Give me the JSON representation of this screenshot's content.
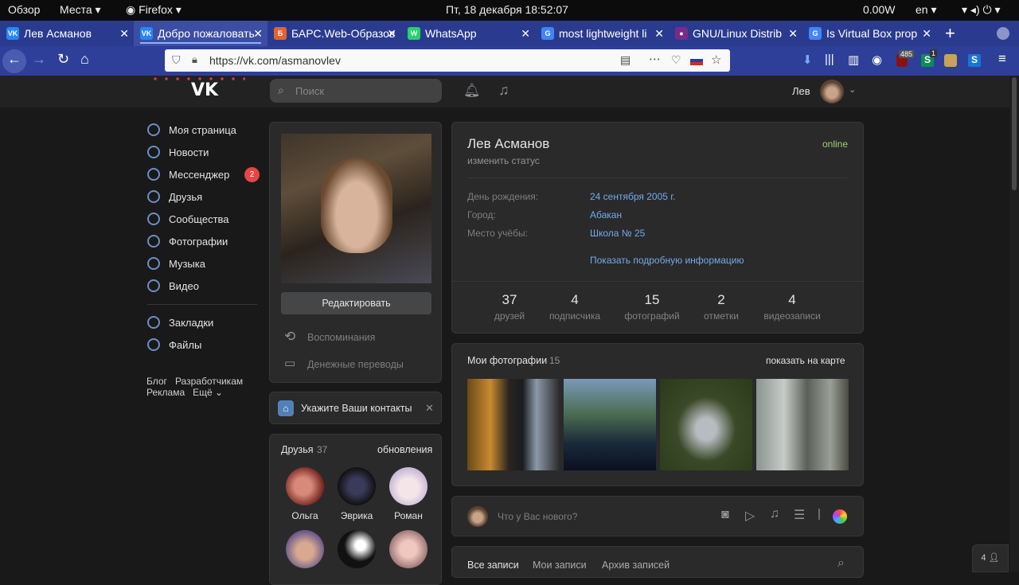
{
  "gnome": {
    "overview": "Обзор",
    "places": "Места ▾",
    "app": "Firefox ▾",
    "clock": "Пт, 18 декабря  18:52:07",
    "power": "0.00W",
    "lang": "en ▾",
    "sys_icons": "▾ ◂) ⏻ ▾"
  },
  "tabs": [
    {
      "label": "Лев Асманов",
      "icon": "VK",
      "color": "#2787f5"
    },
    {
      "label": "Добро пожаловать",
      "icon": "VK",
      "color": "#2787f5"
    },
    {
      "label": "БАРС.Web-Образование",
      "icon": "Б",
      "color": "#e8622a"
    },
    {
      "label": "WhatsApp",
      "icon": "W",
      "color": "#25d366"
    },
    {
      "label": "most lightweight li",
      "icon": "G",
      "color": "#4285f4"
    },
    {
      "label": "GNU/Linux Distrib",
      "icon": "●",
      "color": "#7a2a8a"
    },
    {
      "label": "Is Virtual Box prop",
      "icon": "G",
      "color": "#4285f4"
    }
  ],
  "tab_close": "✕",
  "new_tab": "+",
  "url": "https://vk.com/asmanovlev",
  "badges": {
    "ublock": "485",
    "s1": "1"
  },
  "header": {
    "search_placeholder": "Поиск",
    "user_name": "Лев"
  },
  "menu": [
    {
      "label": "Моя страница",
      "icon": "user-icon"
    },
    {
      "label": "Новости",
      "icon": "news-icon"
    },
    {
      "label": "Мессенджер",
      "icon": "message-icon",
      "badge": "2"
    },
    {
      "label": "Друзья",
      "icon": "friends-icon"
    },
    {
      "label": "Сообщества",
      "icon": "groups-icon"
    },
    {
      "label": "Фотографии",
      "icon": "photo-icon"
    },
    {
      "label": "Музыка",
      "icon": "music-icon"
    },
    {
      "label": "Видео",
      "icon": "video-icon"
    },
    {
      "label": "Закладки",
      "icon": "star-icon"
    },
    {
      "label": "Файлы",
      "icon": "file-icon"
    }
  ],
  "footer_links": {
    "blog": "Блог",
    "dev": "Разработчикам",
    "ads": "Реклама",
    "more": "Ещё ⌄"
  },
  "profile": {
    "edit_button": "Редактировать",
    "memories": "Воспоминания",
    "transfers": "Денежные переводы",
    "contacts_prompt": "Укажите Ваши контакты",
    "name": "Лев Асманов",
    "status": "изменить статус",
    "online": "online",
    "info": [
      {
        "k": "День рождения:",
        "v": "24 сентября 2005 г."
      },
      {
        "k": "Город:",
        "v": "Абакан"
      },
      {
        "k": "Место учёбы:",
        "v": "Школа № 25"
      }
    ],
    "more_info": "Показать подробную информацию",
    "counters": [
      {
        "n": "37",
        "l": "друзей"
      },
      {
        "n": "4",
        "l": "подписчика"
      },
      {
        "n": "15",
        "l": "фотографий"
      },
      {
        "n": "2",
        "l": "отметки"
      },
      {
        "n": "4",
        "l": "видеозаписи"
      }
    ]
  },
  "photos": {
    "title": "Мои фотографии",
    "count": "15",
    "map": "показать на карте"
  },
  "friends": {
    "title": "Друзья",
    "count": "37",
    "updates": "обновления",
    "names": [
      "Ольга",
      "Эврика",
      "Роман"
    ]
  },
  "post": {
    "placeholder": "Что у Вас нового?"
  },
  "wall": {
    "all": "Все записи",
    "mine": "Мои записи",
    "archive": "Архив записей"
  },
  "chat_count": "4"
}
